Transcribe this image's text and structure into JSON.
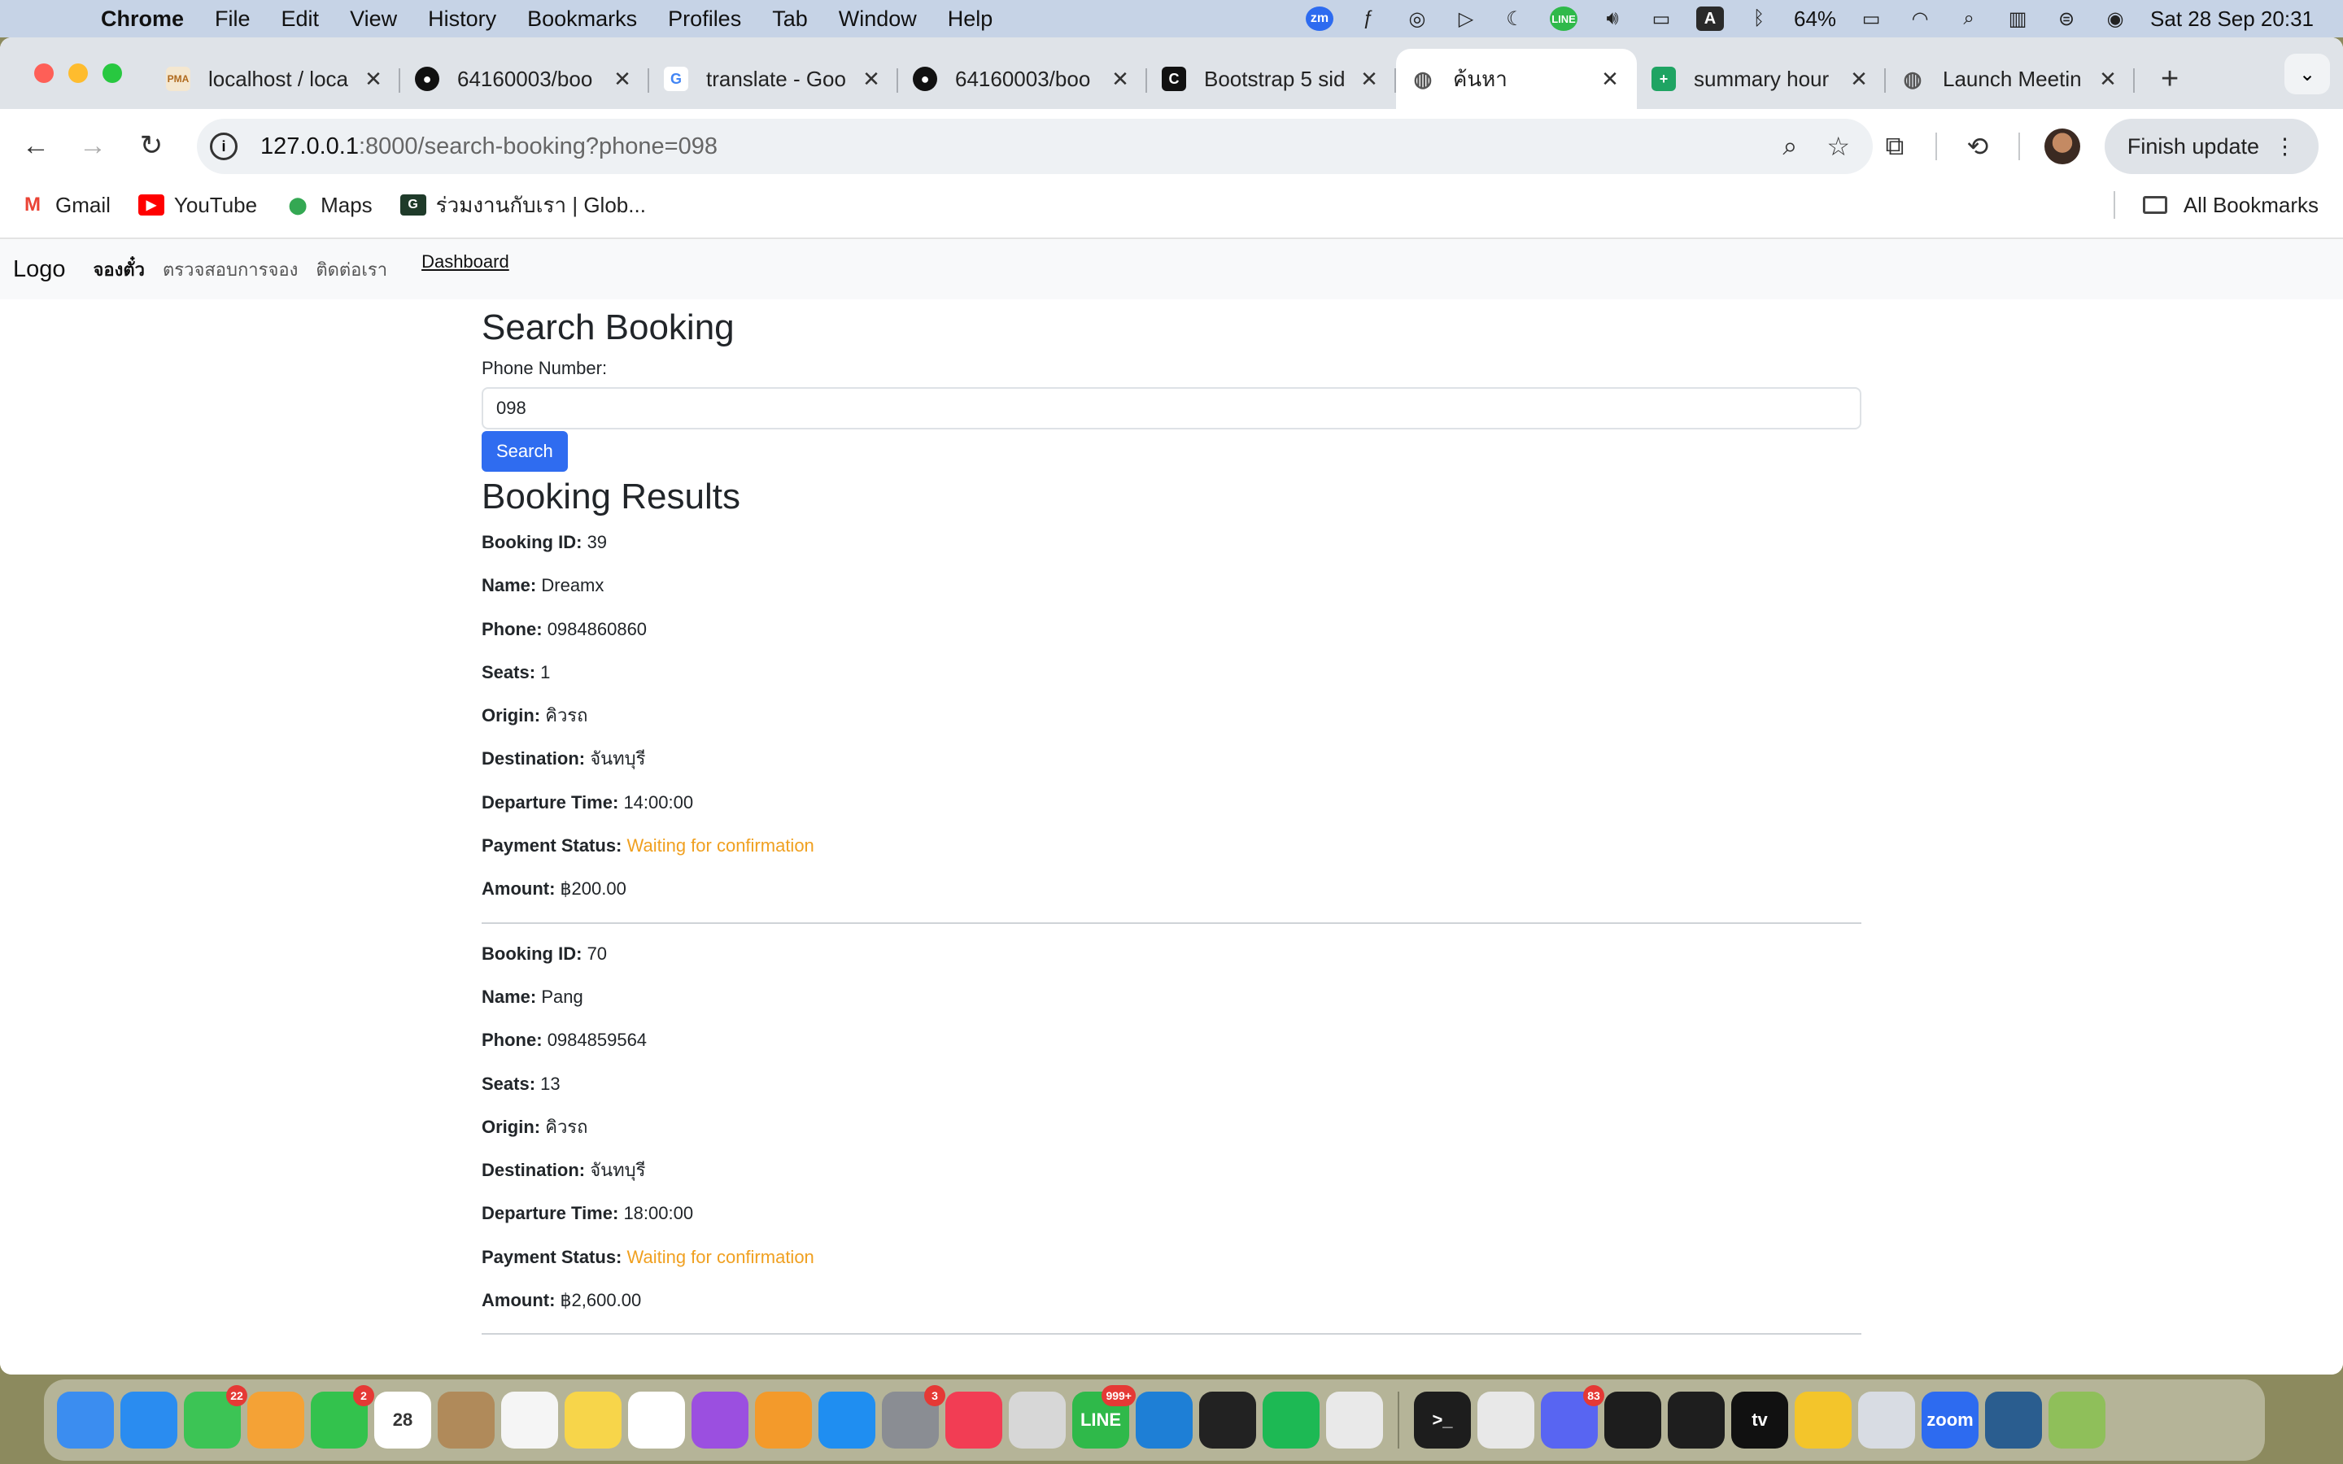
{
  "menubar": {
    "app_name": "Chrome",
    "menus": [
      "File",
      "Edit",
      "View",
      "History",
      "Bookmarks",
      "Profiles",
      "Tab",
      "Window",
      "Help"
    ],
    "battery": "64%",
    "datetime": "Sat 28 Sep  20:31",
    "input_source": "A",
    "zoom_label": "zm",
    "line_label": "LINE"
  },
  "browser": {
    "tabs": [
      {
        "title": "localhost / loca",
        "favicon": "PMA"
      },
      {
        "title": "64160003/boo",
        "favicon": "github"
      },
      {
        "title": "translate - Goo",
        "favicon": "G"
      },
      {
        "title": "64160003/boo",
        "favicon": "github"
      },
      {
        "title": "Bootstrap 5 sid",
        "favicon": "C"
      },
      {
        "title": "ค้นหา",
        "favicon": "globe",
        "active": true
      },
      {
        "title": "summary hour",
        "favicon": "sheets"
      },
      {
        "title": "Launch Meetin",
        "favicon": "globe"
      }
    ],
    "url_host": "127.0.0.1",
    "url_rest": ":8000/search-booking?phone=098",
    "finish_update": "Finish update",
    "bookmarks": [
      {
        "label": "Gmail",
        "icon": "M"
      },
      {
        "label": "YouTube",
        "icon": "▶"
      },
      {
        "label": "Maps",
        "icon": "⬤"
      },
      {
        "label": "ร่วมงานกับเรา | Glob...",
        "icon": "G"
      }
    ],
    "all_bookmarks": "All Bookmarks"
  },
  "site": {
    "brand": "Logo",
    "nav": [
      {
        "label": "จองตั๋ว"
      },
      {
        "label": "ตรวจสอบการจอง"
      },
      {
        "label": "ติดต่อเรา"
      }
    ],
    "dashboard": "Dashboard"
  },
  "search": {
    "title": "Search Booking",
    "label": "Phone Number:",
    "value": "098",
    "button": "Search"
  },
  "results": {
    "title": "Booking Results",
    "labels": {
      "id": "Booking ID:",
      "name": "Name:",
      "phone": "Phone:",
      "seats": "Seats:",
      "origin": "Origin:",
      "destination": "Destination:",
      "departure": "Departure Time:",
      "payment": "Payment Status:",
      "amount": "Amount:"
    },
    "bookings": [
      {
        "id": "39",
        "name": "Dreamx",
        "phone": "0984860860",
        "seats": "1",
        "origin": "คิวรถ",
        "destination": "จันทบุรี",
        "departure": "14:00:00",
        "payment": "Waiting for confirmation",
        "amount": "฿200.00"
      },
      {
        "id": "70",
        "name": "Pang",
        "phone": "0984859564",
        "seats": "13",
        "origin": "คิวรถ",
        "destination": "จันทบุรี",
        "departure": "18:00:00",
        "payment": "Waiting for confirmation",
        "amount": "฿2,600.00"
      }
    ]
  },
  "colors": {
    "accent": "#2f6cf0",
    "status_pending": "#f0a020"
  },
  "dock": {
    "apps": [
      {
        "name": "finder",
        "color": "#3b8df0",
        "label": "",
        "badge": ""
      },
      {
        "name": "safari",
        "color": "#2a8cf0",
        "label": "",
        "badge": ""
      },
      {
        "name": "messages",
        "color": "#3cc455",
        "label": "",
        "badge": "22"
      },
      {
        "name": "photos",
        "color": "#f4a236",
        "label": "",
        "badge": ""
      },
      {
        "name": "facetime",
        "color": "#33c24d",
        "label": "",
        "badge": "2"
      },
      {
        "name": "calendar",
        "color": "#ffffff",
        "label": "28",
        "badge": ""
      },
      {
        "name": "contacts",
        "color": "#b08a5a",
        "label": "",
        "badge": ""
      },
      {
        "name": "reminders",
        "color": "#f5f5f5",
        "label": "",
        "badge": ""
      },
      {
        "name": "notes",
        "color": "#f7d54a",
        "label": "",
        "badge": ""
      },
      {
        "name": "freeform",
        "color": "#ffffff",
        "label": "",
        "badge": ""
      },
      {
        "name": "podcasts",
        "color": "#9b4fe0",
        "label": "",
        "badge": ""
      },
      {
        "name": "pages",
        "color": "#f39a2b",
        "label": "",
        "badge": ""
      },
      {
        "name": "app-store",
        "color": "#1f8ef1",
        "label": "",
        "badge": ""
      },
      {
        "name": "system-settings",
        "color": "#8a8d93",
        "label": "",
        "badge": "3"
      },
      {
        "name": "music",
        "color": "#f23d54",
        "label": "",
        "badge": ""
      },
      {
        "name": "launchpad",
        "color": "#d7d7d7",
        "label": "",
        "badge": ""
      },
      {
        "name": "line",
        "color": "#2fb94a",
        "label": "LINE",
        "badge": "999+"
      },
      {
        "name": "vscode",
        "color": "#1e7fd6",
        "label": "",
        "badge": ""
      },
      {
        "name": "unity",
        "color": "#222222",
        "label": "",
        "badge": ""
      },
      {
        "name": "spotify",
        "color": "#1db954",
        "label": "",
        "badge": ""
      },
      {
        "name": "chrome",
        "color": "#e9e9e9",
        "label": "",
        "badge": ""
      },
      {
        "name": "terminal",
        "color": "#1d1d1d",
        "label": ">_",
        "badge": ""
      },
      {
        "name": "tableplus",
        "color": "#e8e8e8",
        "label": "",
        "badge": ""
      },
      {
        "name": "discord",
        "color": "#5865f2",
        "label": "",
        "badge": "83"
      },
      {
        "name": "activity-monitor",
        "color": "#1d1d1d",
        "label": "",
        "badge": ""
      },
      {
        "name": "figma",
        "color": "#1e1e1e",
        "label": "",
        "badge": ""
      },
      {
        "name": "apple-tv",
        "color": "#111111",
        "label": "tv",
        "badge": ""
      },
      {
        "name": "reeder",
        "color": "#f3c52b",
        "label": "",
        "badge": ""
      },
      {
        "name": "utility",
        "color": "#d8dce3",
        "label": "",
        "badge": ""
      },
      {
        "name": "zoom",
        "color": "#2d6bf0",
        "label": "zoom",
        "badge": ""
      },
      {
        "name": "mysql-workbench",
        "color": "#2a5d8f",
        "label": "",
        "badge": ""
      },
      {
        "name": "grapher",
        "color": "#8fbf5a",
        "label": "",
        "badge": ""
      }
    ]
  }
}
